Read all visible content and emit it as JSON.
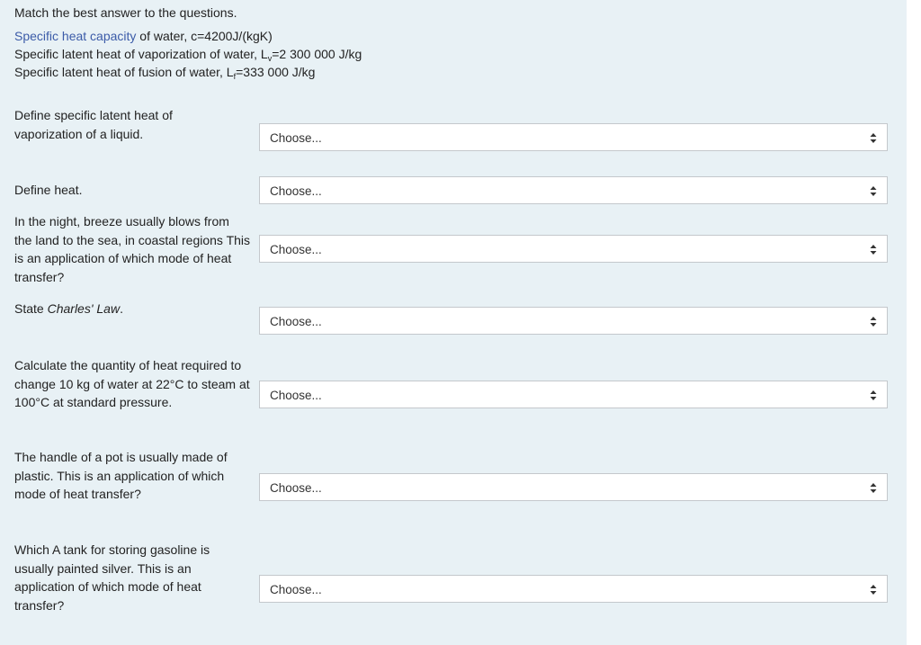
{
  "instructions": "Match the best answer to the questions.",
  "constants": {
    "line1_link": "Specific heat capacity",
    "line1_rest": " of water, c=4200J/(kgK)",
    "line2_prefix": "Specific latent heat of vaporization of water, L",
    "line2_sub": "v",
    "line2_rest": "=2 300 000 J/kg",
    "line3_prefix": "Specific latent heat of fusion of water, L",
    "line3_sub": "f",
    "line3_rest": "=333 000 J/kg"
  },
  "questions": [
    {
      "text": "Define specific latent heat of vaporization of a liquid.",
      "select": "Choose..."
    },
    {
      "text": "Define heat.",
      "select": "Choose..."
    },
    {
      "text": "In the night, breeze usually blows from the land to the sea, in coastal regions This is an application of which mode of heat transfer?",
      "select": "Choose..."
    },
    {
      "text_prefix": "State ",
      "text_em": "Charles' Law",
      "text_suffix": ".",
      "select": "Choose..."
    },
    {
      "text": "Calculate the quantity of heat required to change 10 kg of water at 22°C to steam at 100°C at standard pressure.",
      "select": "Choose..."
    },
    {
      "text": "The handle of a pot is usually made of plastic.  This is an application of which mode of heat transfer?",
      "select": "Choose..."
    },
    {
      "text": "Which A tank for storing gasoline is usually painted silver.  This is an application of which mode of heat transfer?",
      "select": "Choose..."
    }
  ],
  "icons": {
    "select_arrows": "up-down-chevron-icon"
  }
}
